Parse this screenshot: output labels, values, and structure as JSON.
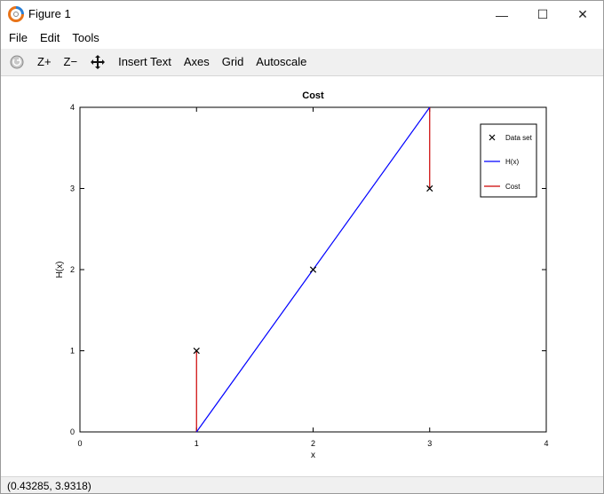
{
  "window": {
    "title": "Figure 1",
    "minimize_glyph": "—",
    "maximize_glyph": "☐",
    "close_glyph": "✕"
  },
  "menu": {
    "items": [
      "File",
      "Edit",
      "Tools"
    ]
  },
  "toolbar": {
    "zoom_in_label": "Z+",
    "zoom_out_label": "Z−",
    "insert_text_label": "Insert Text",
    "axes_label": "Axes",
    "grid_label": "Grid",
    "autoscale_label": "Autoscale",
    "icons": [
      "rotate-icon",
      "pan-icon"
    ]
  },
  "chart_data": {
    "type": "line",
    "title": "Cost",
    "xlabel": "x",
    "ylabel": "H(x)",
    "xlim": [
      0,
      4
    ],
    "ylim": [
      0,
      4
    ],
    "xticks": [
      0,
      1,
      2,
      3,
      4
    ],
    "yticks": [
      0,
      1,
      2,
      3,
      4
    ],
    "grid": false,
    "legend_position": "top-right",
    "series": [
      {
        "name": "Data set",
        "kind": "marker",
        "marker": "x",
        "color": "#000000",
        "x": [
          1,
          2,
          3
        ],
        "y": [
          1,
          2,
          3
        ]
      },
      {
        "name": "H(x)",
        "kind": "line",
        "color": "#0000ff",
        "x": [
          1,
          2,
          3
        ],
        "y": [
          0,
          2,
          4
        ]
      },
      {
        "name": "Cost",
        "kind": "segments",
        "color": "#cc0000",
        "segments": [
          {
            "x": 1,
            "y0": 0,
            "y1": 1
          },
          {
            "x": 3,
            "y0": 3,
            "y1": 4
          }
        ]
      }
    ]
  },
  "status": {
    "coordinates": "(0.43285, 3.9318)"
  }
}
